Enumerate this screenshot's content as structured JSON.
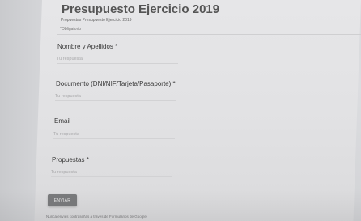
{
  "form": {
    "title": "Presupuesto Ejercicio 2019",
    "description": "Propuestas Presupuesto Ejercicio 2019",
    "required_note": "*Obligatorio"
  },
  "questions": [
    {
      "label": "Nombre y Apellidos *",
      "placeholder": "Tu respuesta"
    },
    {
      "label": "Documento (DNI/NIF/Tarjeta/Pasaporte) *",
      "placeholder": "Tu respuesta"
    },
    {
      "label": "Email",
      "placeholder": "Tu respuesta"
    },
    {
      "label": "Propuestas *",
      "placeholder": "Tu respuesta"
    }
  ],
  "submit_label": "ENVIAR",
  "footer": "Nunca envíes contraseñas a través de Formularios de Google."
}
